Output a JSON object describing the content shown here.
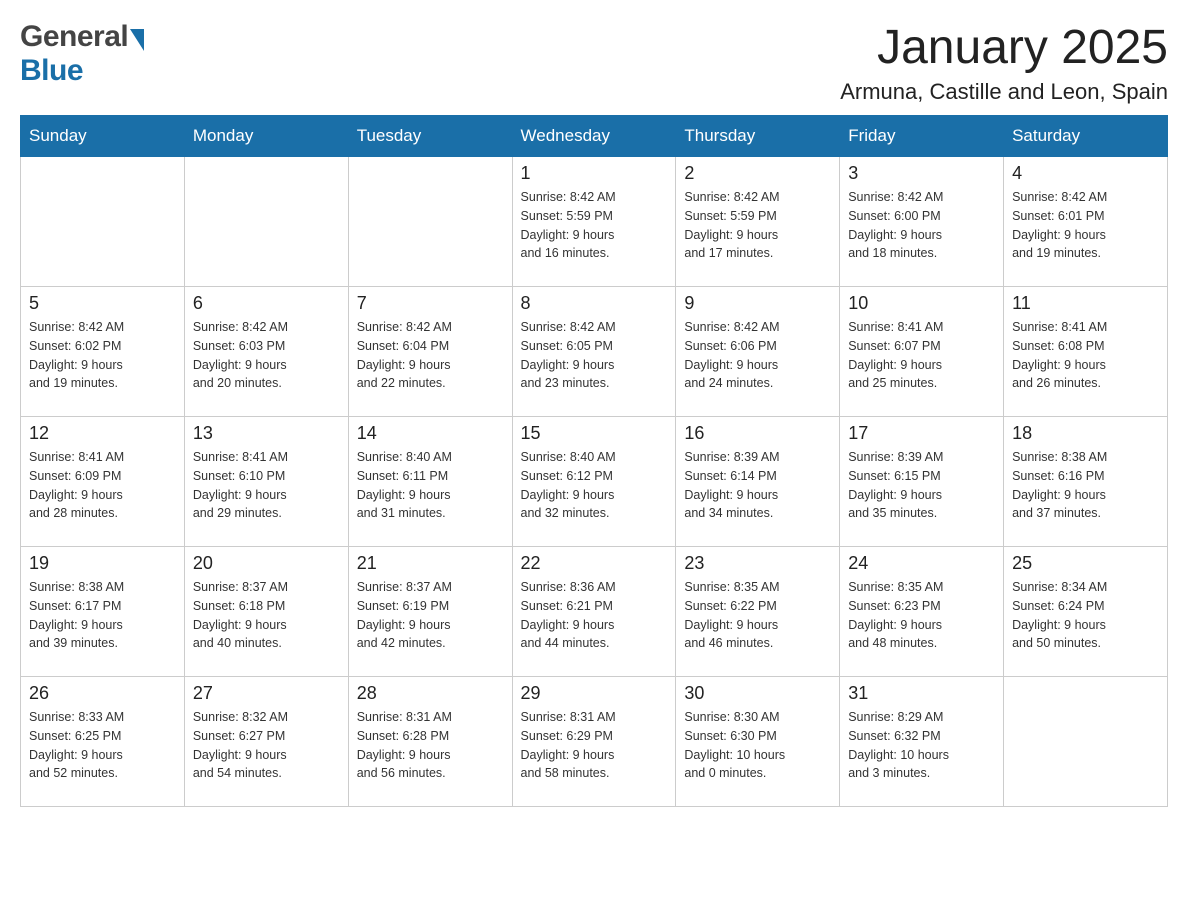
{
  "header": {
    "logo_general": "General",
    "logo_blue": "Blue",
    "month_title": "January 2025",
    "location": "Armuna, Castille and Leon, Spain"
  },
  "days_of_week": [
    "Sunday",
    "Monday",
    "Tuesday",
    "Wednesday",
    "Thursday",
    "Friday",
    "Saturday"
  ],
  "weeks": [
    [
      {
        "day": "",
        "info": ""
      },
      {
        "day": "",
        "info": ""
      },
      {
        "day": "",
        "info": ""
      },
      {
        "day": "1",
        "info": "Sunrise: 8:42 AM\nSunset: 5:59 PM\nDaylight: 9 hours\nand 16 minutes."
      },
      {
        "day": "2",
        "info": "Sunrise: 8:42 AM\nSunset: 5:59 PM\nDaylight: 9 hours\nand 17 minutes."
      },
      {
        "day": "3",
        "info": "Sunrise: 8:42 AM\nSunset: 6:00 PM\nDaylight: 9 hours\nand 18 minutes."
      },
      {
        "day": "4",
        "info": "Sunrise: 8:42 AM\nSunset: 6:01 PM\nDaylight: 9 hours\nand 19 minutes."
      }
    ],
    [
      {
        "day": "5",
        "info": "Sunrise: 8:42 AM\nSunset: 6:02 PM\nDaylight: 9 hours\nand 19 minutes."
      },
      {
        "day": "6",
        "info": "Sunrise: 8:42 AM\nSunset: 6:03 PM\nDaylight: 9 hours\nand 20 minutes."
      },
      {
        "day": "7",
        "info": "Sunrise: 8:42 AM\nSunset: 6:04 PM\nDaylight: 9 hours\nand 22 minutes."
      },
      {
        "day": "8",
        "info": "Sunrise: 8:42 AM\nSunset: 6:05 PM\nDaylight: 9 hours\nand 23 minutes."
      },
      {
        "day": "9",
        "info": "Sunrise: 8:42 AM\nSunset: 6:06 PM\nDaylight: 9 hours\nand 24 minutes."
      },
      {
        "day": "10",
        "info": "Sunrise: 8:41 AM\nSunset: 6:07 PM\nDaylight: 9 hours\nand 25 minutes."
      },
      {
        "day": "11",
        "info": "Sunrise: 8:41 AM\nSunset: 6:08 PM\nDaylight: 9 hours\nand 26 minutes."
      }
    ],
    [
      {
        "day": "12",
        "info": "Sunrise: 8:41 AM\nSunset: 6:09 PM\nDaylight: 9 hours\nand 28 minutes."
      },
      {
        "day": "13",
        "info": "Sunrise: 8:41 AM\nSunset: 6:10 PM\nDaylight: 9 hours\nand 29 minutes."
      },
      {
        "day": "14",
        "info": "Sunrise: 8:40 AM\nSunset: 6:11 PM\nDaylight: 9 hours\nand 31 minutes."
      },
      {
        "day": "15",
        "info": "Sunrise: 8:40 AM\nSunset: 6:12 PM\nDaylight: 9 hours\nand 32 minutes."
      },
      {
        "day": "16",
        "info": "Sunrise: 8:39 AM\nSunset: 6:14 PM\nDaylight: 9 hours\nand 34 minutes."
      },
      {
        "day": "17",
        "info": "Sunrise: 8:39 AM\nSunset: 6:15 PM\nDaylight: 9 hours\nand 35 minutes."
      },
      {
        "day": "18",
        "info": "Sunrise: 8:38 AM\nSunset: 6:16 PM\nDaylight: 9 hours\nand 37 minutes."
      }
    ],
    [
      {
        "day": "19",
        "info": "Sunrise: 8:38 AM\nSunset: 6:17 PM\nDaylight: 9 hours\nand 39 minutes."
      },
      {
        "day": "20",
        "info": "Sunrise: 8:37 AM\nSunset: 6:18 PM\nDaylight: 9 hours\nand 40 minutes."
      },
      {
        "day": "21",
        "info": "Sunrise: 8:37 AM\nSunset: 6:19 PM\nDaylight: 9 hours\nand 42 minutes."
      },
      {
        "day": "22",
        "info": "Sunrise: 8:36 AM\nSunset: 6:21 PM\nDaylight: 9 hours\nand 44 minutes."
      },
      {
        "day": "23",
        "info": "Sunrise: 8:35 AM\nSunset: 6:22 PM\nDaylight: 9 hours\nand 46 minutes."
      },
      {
        "day": "24",
        "info": "Sunrise: 8:35 AM\nSunset: 6:23 PM\nDaylight: 9 hours\nand 48 minutes."
      },
      {
        "day": "25",
        "info": "Sunrise: 8:34 AM\nSunset: 6:24 PM\nDaylight: 9 hours\nand 50 minutes."
      }
    ],
    [
      {
        "day": "26",
        "info": "Sunrise: 8:33 AM\nSunset: 6:25 PM\nDaylight: 9 hours\nand 52 minutes."
      },
      {
        "day": "27",
        "info": "Sunrise: 8:32 AM\nSunset: 6:27 PM\nDaylight: 9 hours\nand 54 minutes."
      },
      {
        "day": "28",
        "info": "Sunrise: 8:31 AM\nSunset: 6:28 PM\nDaylight: 9 hours\nand 56 minutes."
      },
      {
        "day": "29",
        "info": "Sunrise: 8:31 AM\nSunset: 6:29 PM\nDaylight: 9 hours\nand 58 minutes."
      },
      {
        "day": "30",
        "info": "Sunrise: 8:30 AM\nSunset: 6:30 PM\nDaylight: 10 hours\nand 0 minutes."
      },
      {
        "day": "31",
        "info": "Sunrise: 8:29 AM\nSunset: 6:32 PM\nDaylight: 10 hours\nand 3 minutes."
      },
      {
        "day": "",
        "info": ""
      }
    ]
  ]
}
